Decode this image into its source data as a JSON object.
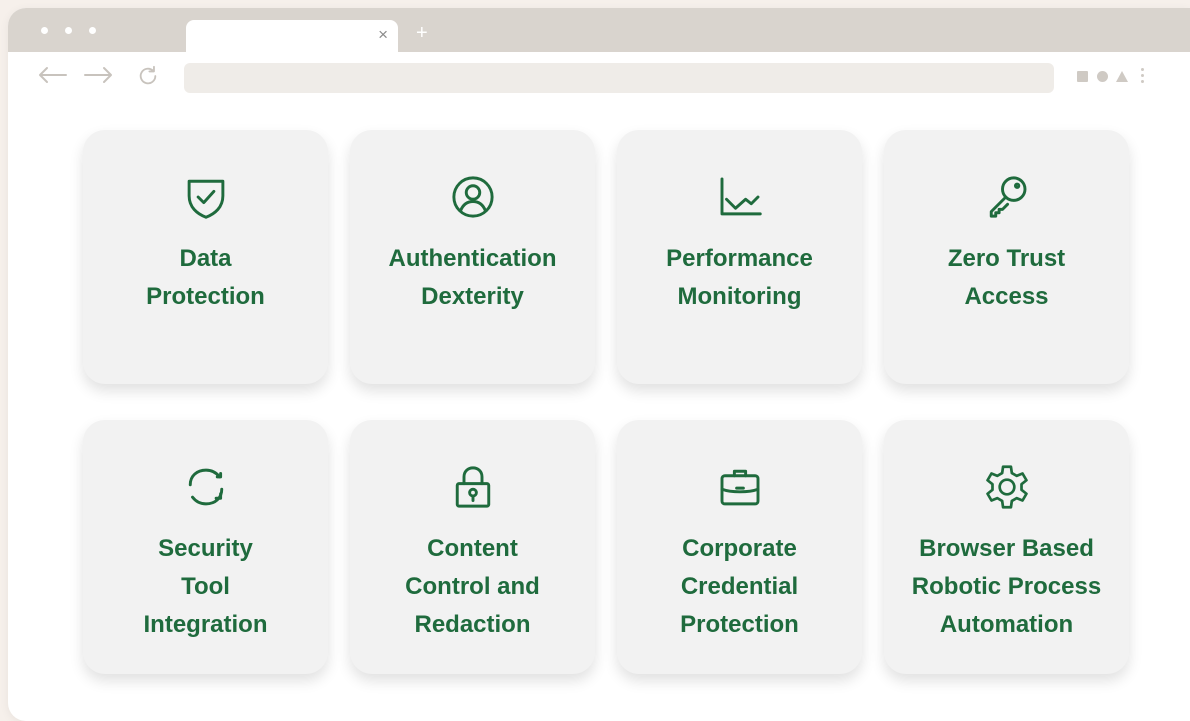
{
  "browser": {
    "tab": {
      "close_glyph": "×"
    },
    "new_tab_glyph": "+",
    "address_bar": {
      "value": "",
      "star_glyph": "★"
    }
  },
  "colors": {
    "accent": "#1f6b3d",
    "card_bg": "#f2f2f2",
    "page_bg": "#f6f0eb",
    "tabstrip": "#d9d4ce"
  },
  "features": [
    {
      "label": "Data\nProtection",
      "icon": "shield-check-icon"
    },
    {
      "label": "Authentication\nDexterity",
      "icon": "user-circle-icon"
    },
    {
      "label": "Performance\nMonitoring",
      "icon": "line-chart-icon"
    },
    {
      "label": "Zero Trust\nAccess",
      "icon": "key-icon"
    },
    {
      "label": "Security\nTool\nIntegration",
      "icon": "sync-arrows-icon"
    },
    {
      "label": "Content\nControl and\nRedaction",
      "icon": "padlock-icon"
    },
    {
      "label": "Corporate\nCredential\nProtection",
      "icon": "briefcase-icon"
    },
    {
      "label": "Browser Based\nRobotic Process\nAutomation",
      "icon": "gear-icon"
    }
  ]
}
